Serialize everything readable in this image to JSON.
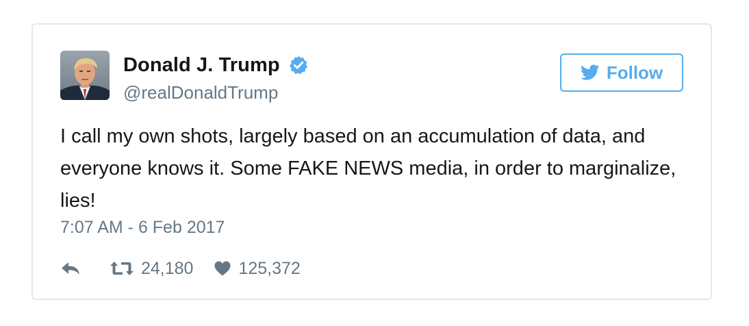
{
  "author": {
    "display_name": "Donald J. Trump",
    "handle": "@realDonaldTrump",
    "verified": true,
    "avatar_icon": "profile-photo"
  },
  "follow_button": {
    "label": "Follow",
    "icon": "twitter-bird-icon"
  },
  "tweet": {
    "text": "I call my own shots, largely based on an accumulation of data, and everyone knows it. Some FAKE NEWS media, in order to marginalize, lies!",
    "timestamp": "7:07 AM - 6 Feb 2017"
  },
  "actions": {
    "reply_icon": "reply-icon",
    "retweet_icon": "retweet-icon",
    "retweet_count": "24,180",
    "like_icon": "heart-icon",
    "like_count": "125,372"
  },
  "colors": {
    "accent": "#55acee",
    "text": "#14171a",
    "secondary": "#657786",
    "border": "#e1e8ed"
  }
}
